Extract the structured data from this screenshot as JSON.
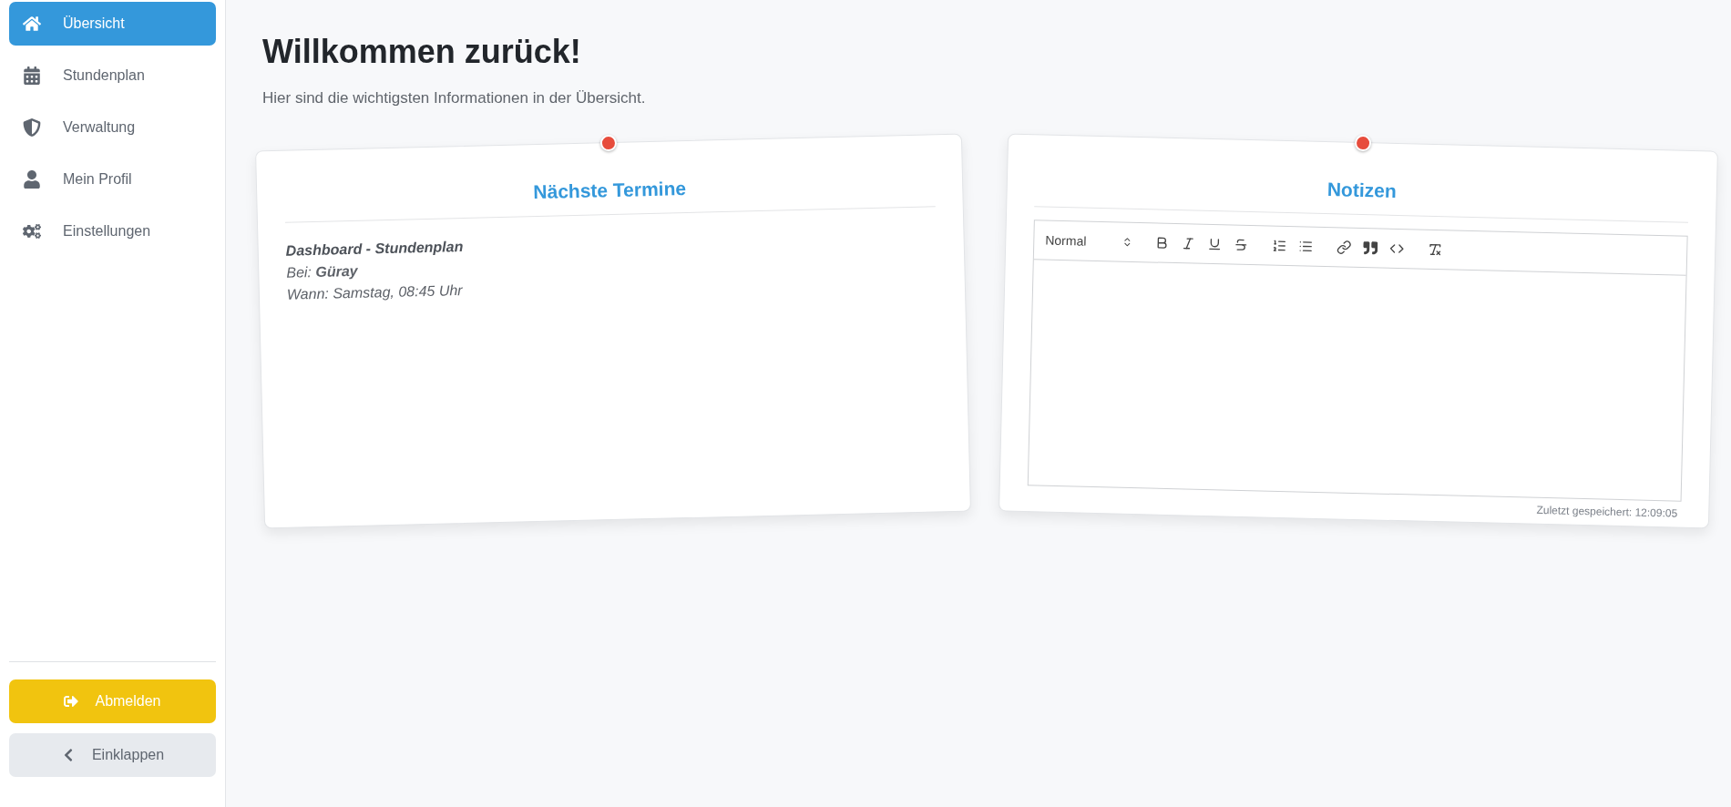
{
  "sidebar": {
    "items": [
      {
        "label": "Übersicht",
        "kind": "home",
        "selected": true
      },
      {
        "label": "Stundenplan",
        "kind": "calendar",
        "selected": false
      },
      {
        "label": "Verwaltung",
        "kind": "shield",
        "selected": false
      },
      {
        "label": "Mein Profil",
        "kind": "user",
        "selected": false
      },
      {
        "label": "Einstellungen",
        "kind": "gears",
        "selected": false
      }
    ],
    "logout_button": "Abmelden",
    "collapse_button": "Einklappen"
  },
  "header": {
    "title": "Willkommen zurück!",
    "subtitle": "Hier sind die wichtigsten Informationen in der Übersicht."
  },
  "appointments_card": {
    "title": "Nächste Termine",
    "appointments": [
      {
        "title": "Dashboard - Stundenplan",
        "with": "Bei: **Güray**",
        "when": "Wann: Samstag, 08:45 Uhr"
      }
    ]
  },
  "notes_card": {
    "title": "Notizen",
    "editor": {
      "format": "Normal",
      "tool_groups": [
        [
          {
            "kind": "bold"
          },
          {
            "kind": "italic"
          },
          {
            "kind": "underline"
          },
          {
            "kind": "strike"
          }
        ],
        [
          {
            "kind": "ordered"
          },
          {
            "kind": "bullet"
          }
        ],
        [
          {
            "kind": "link"
          },
          {
            "kind": "quote"
          },
          {
            "kind": "code"
          }
        ],
        [
          {
            "kind": "clean"
          }
        ]
      ]
    },
    "saved": "Zuletzt gespeichert: 12:09:05"
  }
}
